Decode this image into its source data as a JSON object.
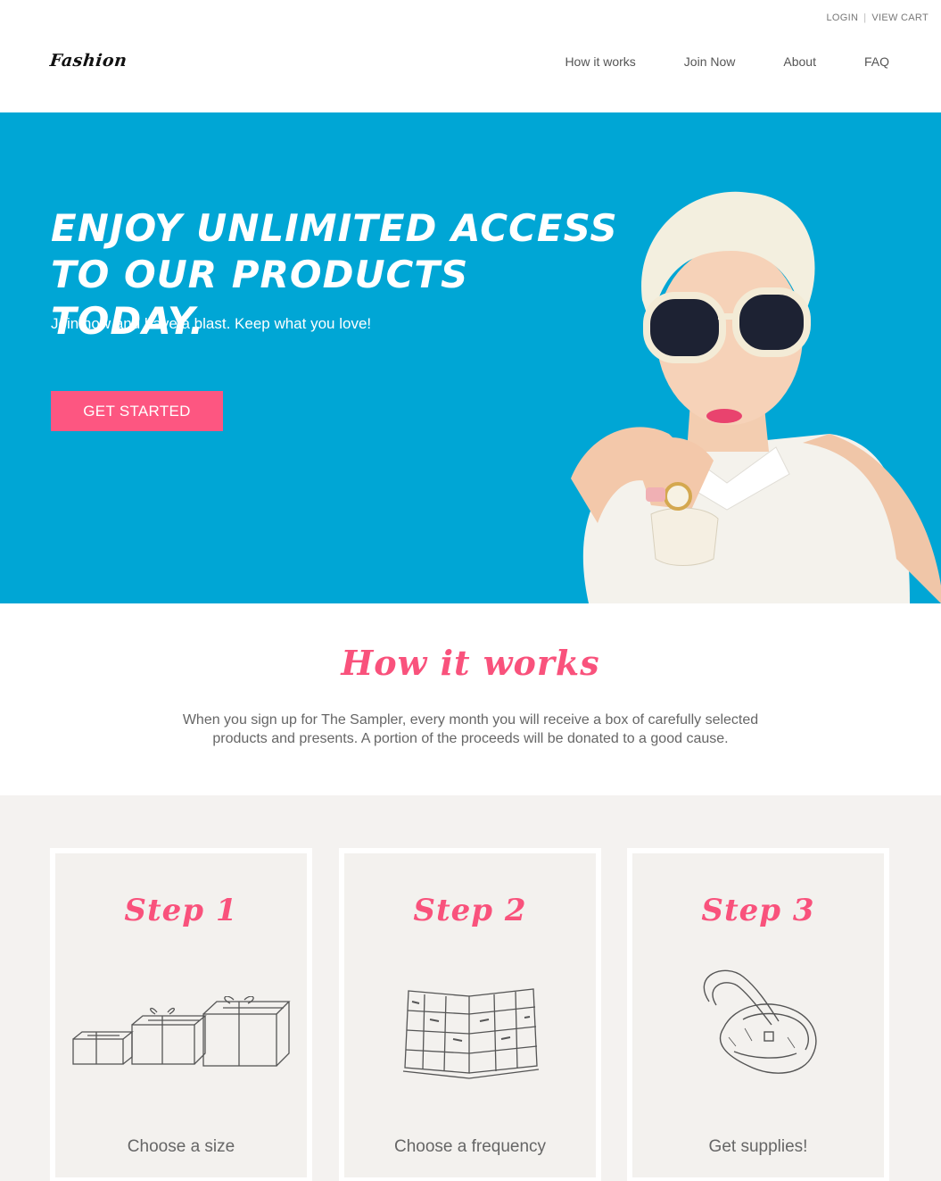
{
  "util": {
    "login": "LOGIN",
    "cart": "VIEW CART"
  },
  "header": {
    "logo": "Fashion",
    "nav": [
      "How it works",
      "Join Now",
      "About",
      "FAQ"
    ]
  },
  "hero": {
    "headline": "Enjoy unlimited access to our products today.",
    "subheadline": "Join now and have a blast. Keep what you love!",
    "cta": "GET STARTED",
    "bg_color": "#00a6d5",
    "cta_color": "#fd5681"
  },
  "how": {
    "title": "How it works",
    "description": "When you sign up for The Sampler, every month you will receive a box of carefully selected products and presents. A portion of the proceeds will be donated to a good cause."
  },
  "steps": [
    {
      "title": "Step 1",
      "caption": "Choose a size",
      "icon": "gift-boxes-icon"
    },
    {
      "title": "Step 2",
      "caption": "Choose a frequency",
      "icon": "open-book-icon"
    },
    {
      "title": "Step 3",
      "caption": "Get supplies!",
      "icon": "handbag-icon"
    }
  ]
}
